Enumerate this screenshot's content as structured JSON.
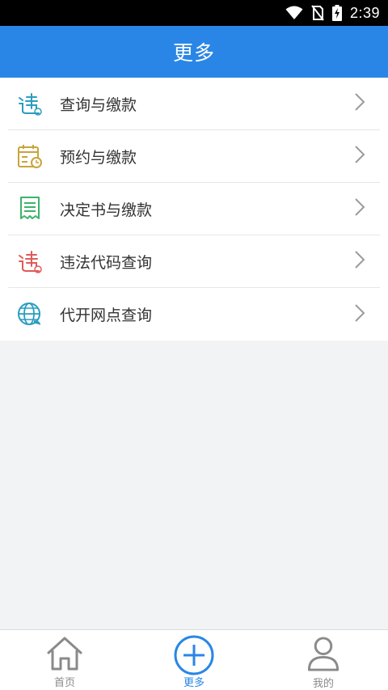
{
  "status_bar": {
    "time": "2:39",
    "icons": [
      "wifi-icon",
      "no-sim-icon",
      "battery-charging-icon"
    ]
  },
  "header": {
    "title": "更多"
  },
  "menu": {
    "items": [
      {
        "label": "查询与缴款",
        "icon": "violation-icon",
        "icon_color": "#2a9dc0"
      },
      {
        "label": "预约与缴款",
        "icon": "calendar-clock-icon",
        "icon_color": "#c8a43a"
      },
      {
        "label": "决定书与缴款",
        "icon": "document-icon",
        "icon_color": "#3bb46a"
      },
      {
        "label": "违法代码查询",
        "icon": "violation-code-icon",
        "icon_color": "#e05a5a"
      },
      {
        "label": "代开网点查询",
        "icon": "globe-icon",
        "icon_color": "#2a9dc0"
      }
    ]
  },
  "tab_bar": {
    "tabs": [
      {
        "label": "首页",
        "icon": "home-icon",
        "active": false
      },
      {
        "label": "更多",
        "icon": "plus-circle-icon",
        "active": true
      },
      {
        "label": "我的",
        "icon": "user-icon",
        "active": false
      }
    ]
  },
  "colors": {
    "accent": "#2a86e6",
    "background": "#f2f3f4"
  }
}
